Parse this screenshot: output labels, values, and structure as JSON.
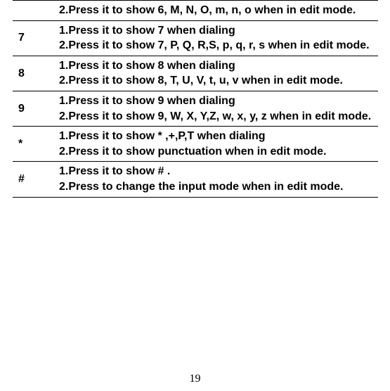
{
  "rows": [
    {
      "key": "",
      "desc": "2.Press it to show  6, M, N, O, m, n, o when in edit mode."
    },
    {
      "key": "7",
      "desc": "1.Press it to show 7 when dialing\n2.Press it to show  7, P, Q, R,S, p, q, r, s when in edit mode."
    },
    {
      "key": "8",
      "desc": "1.Press it to show 8 when dialing\n2.Press it to show  8, T, U, V, t, u, v when in edit mode."
    },
    {
      "key": "9",
      "desc": "1.Press it to show 9 when dialing\n2.Press it to show  9, W, X, Y,Z, w, x, y, z when in edit mode."
    },
    {
      "key": "*",
      "desc": "1.Press it to show * ,+,P,T when dialing\n2.Press it to show punctuation  when in edit mode."
    },
    {
      "key": "#",
      "desc": "1.Press it to show # .\n2.Press to change the input mode when in edit mode."
    }
  ],
  "page_number": "19"
}
